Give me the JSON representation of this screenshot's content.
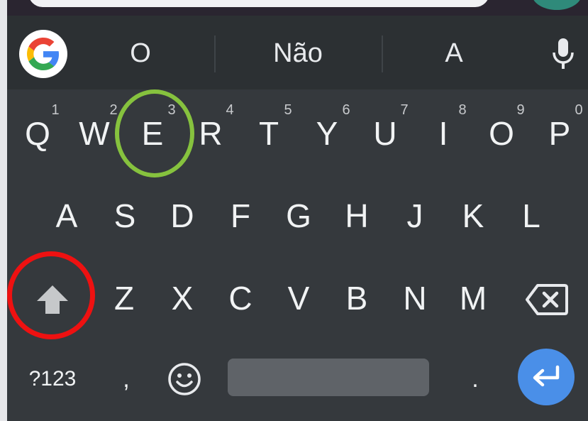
{
  "suggestions": [
    "O",
    "Não",
    "A"
  ],
  "keyboard": {
    "row1": [
      {
        "key": "Q",
        "hint": "1"
      },
      {
        "key": "W",
        "hint": "2"
      },
      {
        "key": "E",
        "hint": "3"
      },
      {
        "key": "R",
        "hint": "4"
      },
      {
        "key": "T",
        "hint": "5"
      },
      {
        "key": "Y",
        "hint": "6"
      },
      {
        "key": "U",
        "hint": "7"
      },
      {
        "key": "I",
        "hint": "8"
      },
      {
        "key": "O",
        "hint": "9"
      },
      {
        "key": "P",
        "hint": "0"
      }
    ],
    "row2": [
      "A",
      "S",
      "D",
      "F",
      "G",
      "H",
      "J",
      "K",
      "L"
    ],
    "row3": [
      "Z",
      "X",
      "C",
      "V",
      "B",
      "N",
      "M"
    ],
    "bottom": {
      "symbols_label": "?123",
      "comma": ",",
      "period": "."
    }
  },
  "icons": {
    "logo": "google-g-icon",
    "mic": "microphone-icon",
    "shift": "shift-icon",
    "backspace": "backspace-icon",
    "emoji": "emoji-icon",
    "enter": "enter-icon"
  },
  "colors": {
    "keyboard_bg": "#35393d",
    "suggestion_bg": "#2c3033",
    "key_text": "#f1f3f4",
    "enter_key": "#4a8fe8",
    "highlight_green": "#86c23e",
    "highlight_red": "#ee1111"
  }
}
